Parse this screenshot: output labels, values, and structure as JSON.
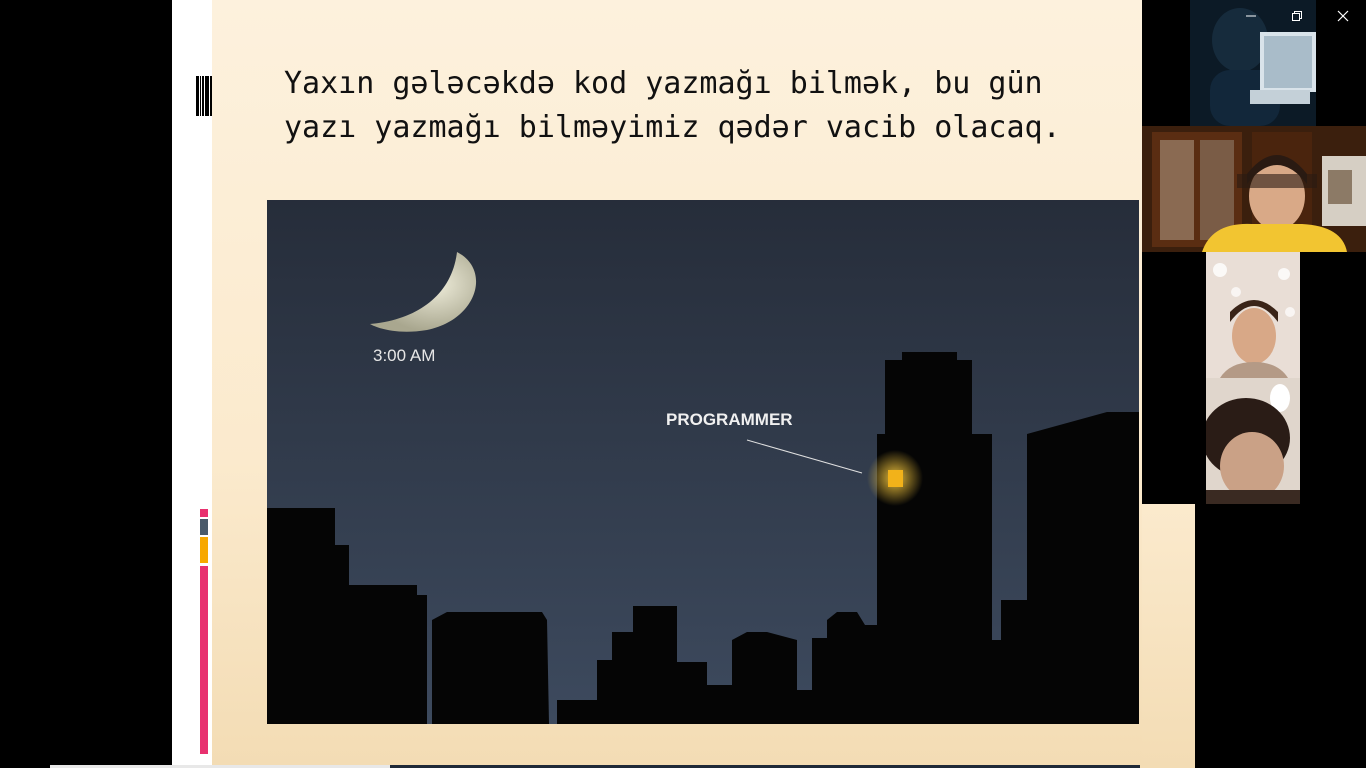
{
  "window_controls": {
    "minimize": "minimize-icon",
    "restore": "restore-icon",
    "close": "close-icon"
  },
  "slide": {
    "title": "Yaxın gələcəkdə kod yazmağı bilmək, bu gün\nyazı yazmağı bilməyimiz qədər vacib olacaq.",
    "image": {
      "time_label": "3:00 AM",
      "programmer_label": "PROGRAMMER"
    }
  },
  "colors": {
    "slide_background": "#fbeacd",
    "accent_pink": "#e8316f",
    "accent_slate": "#4a5a6a",
    "accent_orange": "#f7a800",
    "night_sky": "#2c3444",
    "window_light": "#f2b21a"
  },
  "participants": [
    {
      "id": "participant-1"
    },
    {
      "id": "participant-2"
    },
    {
      "id": "participant-3"
    },
    {
      "id": "participant-4"
    }
  ]
}
